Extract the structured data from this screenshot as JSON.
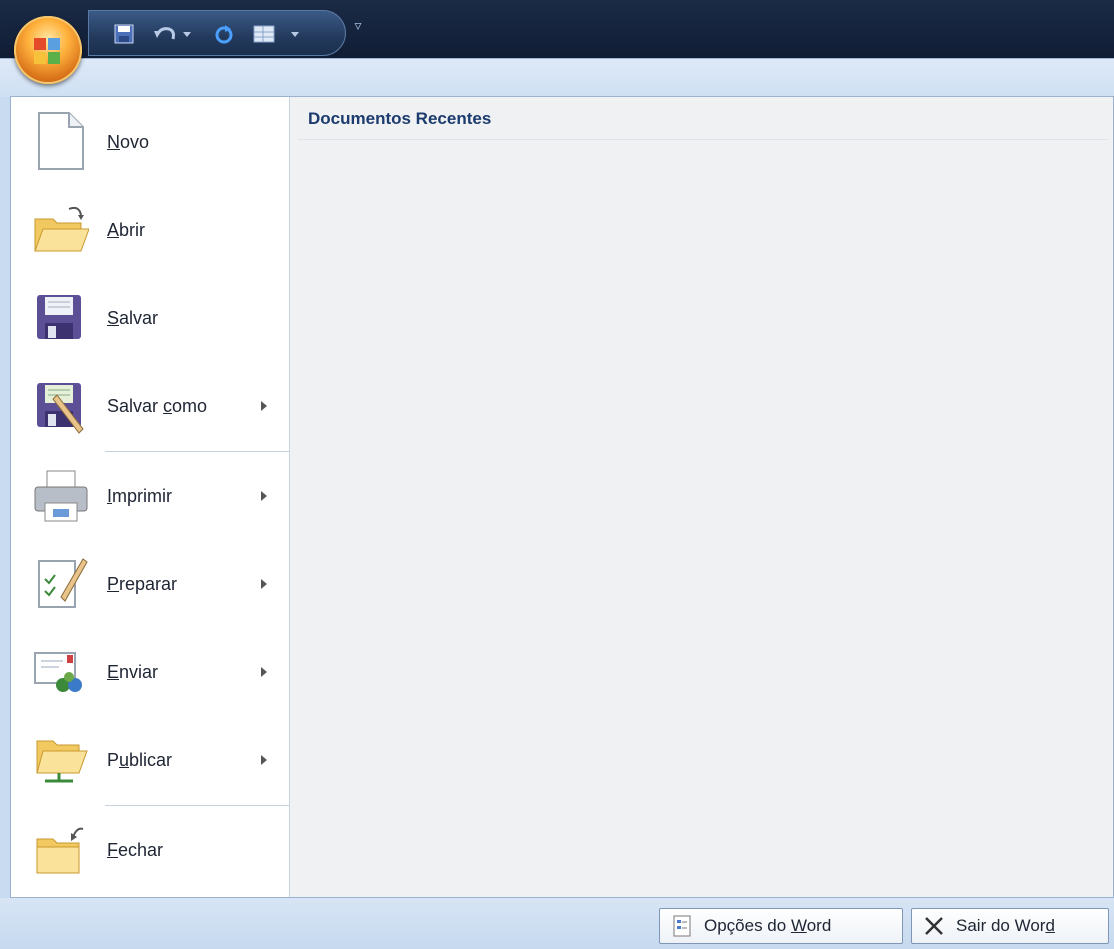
{
  "quick_access": {
    "items": [
      "save-icon",
      "undo-icon",
      "redo-icon",
      "table-icon",
      "customize-arrow-icon"
    ]
  },
  "menu": {
    "items": [
      {
        "label_pre": "",
        "label_key": "N",
        "label_post": "ovo",
        "has_submenu": false
      },
      {
        "label_pre": "",
        "label_key": "A",
        "label_post": "brir",
        "has_submenu": false
      },
      {
        "label_pre": "",
        "label_key": "S",
        "label_post": "alvar",
        "has_submenu": false
      },
      {
        "label_pre": "Salvar ",
        "label_key": "c",
        "label_post": "omo",
        "has_submenu": true
      },
      {
        "label_pre": "",
        "label_key": "I",
        "label_post": "mprimir",
        "has_submenu": true
      },
      {
        "label_pre": "",
        "label_key": "P",
        "label_post": "reparar",
        "has_submenu": true
      },
      {
        "label_pre": "",
        "label_key": "E",
        "label_post": "nviar",
        "has_submenu": true
      },
      {
        "label_pre": "P",
        "label_key": "u",
        "label_post": "blicar",
        "has_submenu": true
      },
      {
        "label_pre": "",
        "label_key": "F",
        "label_post": "echar",
        "has_submenu": false
      }
    ]
  },
  "recent": {
    "title": "Documentos Recentes"
  },
  "bottom": {
    "options_pre": "Opções do ",
    "options_key": "W",
    "options_post": "ord",
    "exit_pre": "Sair do Wor",
    "exit_key": "d",
    "exit_post": ""
  }
}
